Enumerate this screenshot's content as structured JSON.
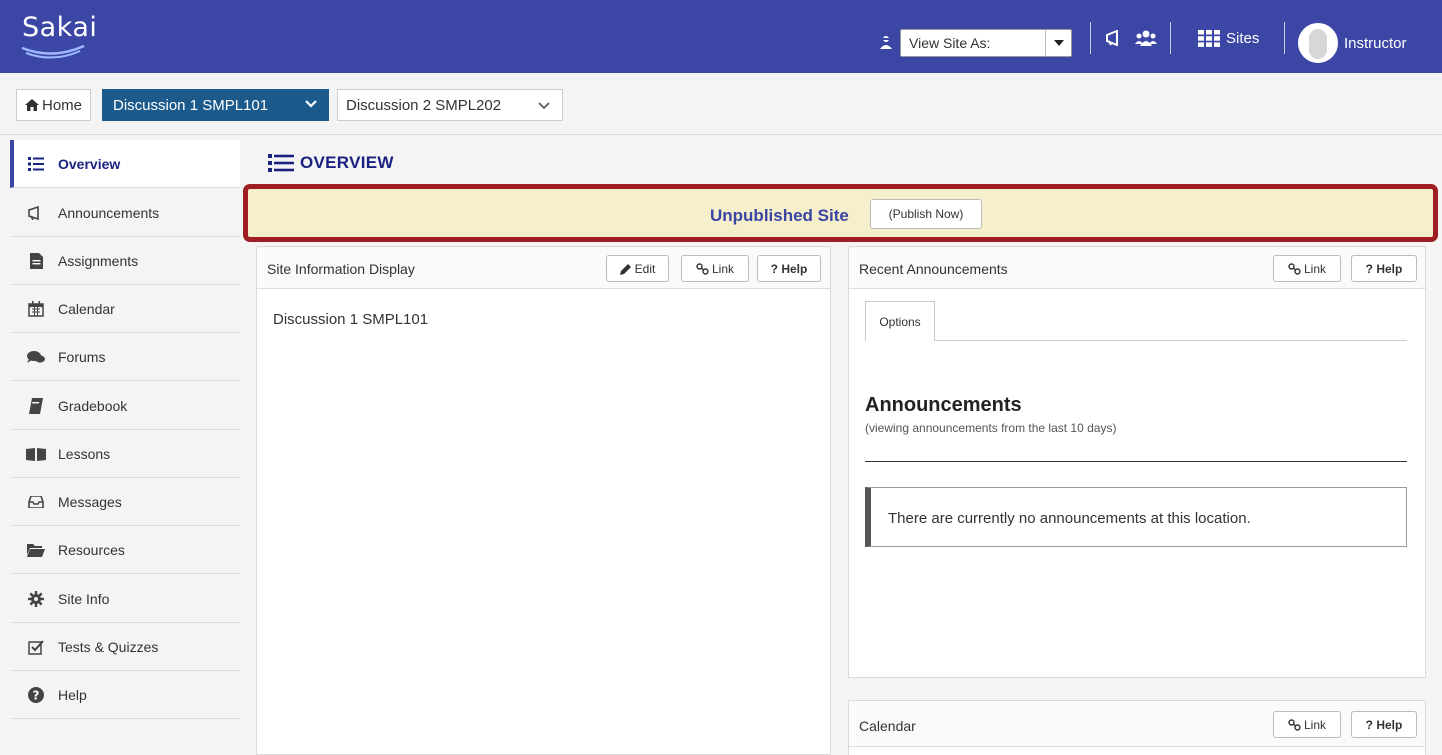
{
  "header": {
    "logo_text": "Sakai",
    "view_site_as": "View Site As:",
    "sites_label": "Sites",
    "user_name": "Instructor",
    "colors": {
      "bar": "#3b46a5"
    }
  },
  "site_tabs": {
    "home": "Home",
    "active": "Discussion 1 SMPL101",
    "other": "Discussion 2 SMPL202"
  },
  "tools": [
    {
      "label": "Overview",
      "icon": "list-icon"
    },
    {
      "label": "Announcements",
      "icon": "megaphone-icon"
    },
    {
      "label": "Assignments",
      "icon": "file-icon"
    },
    {
      "label": "Calendar",
      "icon": "calendar-icon"
    },
    {
      "label": "Forums",
      "icon": "comments-icon"
    },
    {
      "label": "Gradebook",
      "icon": "book-icon"
    },
    {
      "label": "Lessons",
      "icon": "open-book-icon"
    },
    {
      "label": "Messages",
      "icon": "inbox-icon"
    },
    {
      "label": "Resources",
      "icon": "folder-open-icon"
    },
    {
      "label": "Site Info",
      "icon": "gear-icon"
    },
    {
      "label": "Tests & Quizzes",
      "icon": "checkbox-icon"
    },
    {
      "label": "Help",
      "icon": "question-circle-icon"
    }
  ],
  "content": {
    "page_title": "OVERVIEW",
    "banner": {
      "text": "Unpublished Site",
      "button": "(Publish Now)"
    },
    "site_info": {
      "title": "Site Information Display",
      "edit": "Edit",
      "link": "Link",
      "help": "? Help",
      "body": "Discussion 1 SMPL101"
    },
    "recent_announcements": {
      "title": "Recent Announcements",
      "link": "Link",
      "help": "? Help",
      "options_tab": "Options",
      "heading": "Announcements",
      "subheading": "(viewing announcements from the last 10 days)",
      "empty_message": "There are currently no announcements at this location."
    },
    "calendar": {
      "title": "Calendar",
      "link": "Link",
      "help": "? Help"
    }
  }
}
